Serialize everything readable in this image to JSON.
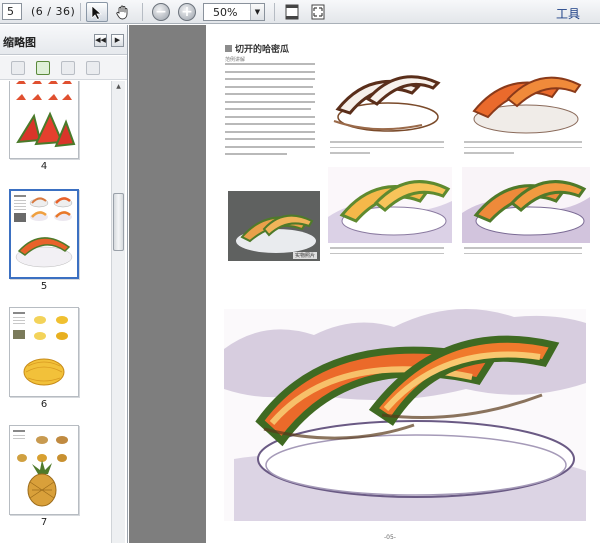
{
  "toolbar": {
    "page_value": "5",
    "page_count": "(6 / 36)",
    "zoom": "50%",
    "tools_label": "工具"
  },
  "sidebar": {
    "title": "缩略图",
    "thumbnails": [
      {
        "label": "4"
      },
      {
        "label": "5",
        "selected": true
      },
      {
        "label": "6"
      },
      {
        "label": "7"
      }
    ]
  },
  "page": {
    "title": "切开的哈密瓜",
    "subtitle": "范例讲解",
    "photo_label": "实物照片",
    "footer": "-05-"
  },
  "colors": {
    "accent": "#3b70c2",
    "doc_background": "#7e7e7e",
    "melon_orange": "#e8622a",
    "rind_green": "#4f7a2a"
  }
}
